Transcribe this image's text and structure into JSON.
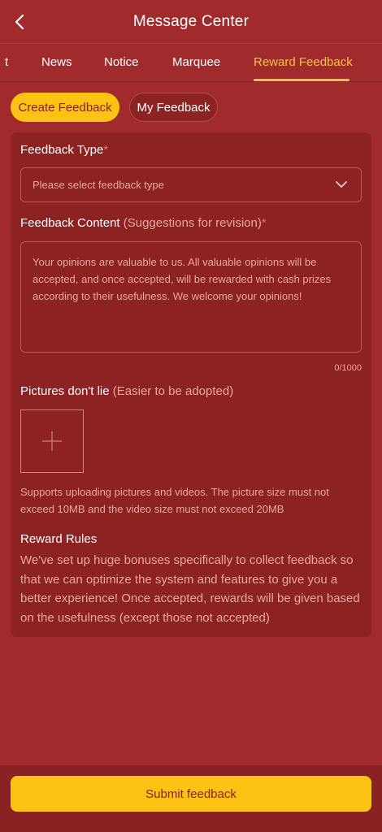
{
  "header": {
    "title": "Message Center"
  },
  "tabs": [
    {
      "label": "t"
    },
    {
      "label": "News"
    },
    {
      "label": "Notice"
    },
    {
      "label": "Marquee"
    },
    {
      "label": "Reward Feedback"
    }
  ],
  "sub_tabs": {
    "create": "Create Feedback",
    "mine": "My Feedback"
  },
  "form": {
    "type_label": "Feedback Type",
    "required_mark": "*",
    "type_placeholder": "Please select feedback type",
    "content_label": "Feedback Content",
    "content_hint": "(Suggestions for revision)",
    "content_placeholder": "Your opinions are valuable to us. All valuable opinions will be accepted, and once accepted, will be rewarded with cash prizes according to their usefulness. We welcome your opinions!",
    "counter": "0/1000",
    "pictures_label": "Pictures don't lie",
    "pictures_hint": "(Easier to be adopted)",
    "upload_hint": "Supports uploading pictures and videos. The picture size must not exceed 10MB and the video size must not exceed 20MB"
  },
  "rules": {
    "title": "Reward Rules",
    "text": "We've set up huge bonuses specifically to collect feedback so that we can optimize the system and features to give you a better experience! Once accepted, rewards will be given based on the usefulness (except those not accepted)"
  },
  "submit_label": "Submit feedback",
  "colors": {
    "background": "#a02a2c",
    "card": "#8c2222",
    "accent": "#fcc214",
    "active_tab": "#f6c344"
  },
  "icons": {
    "back": "chevron-left-icon",
    "dropdown": "chevron-down-icon",
    "upload": "plus-icon"
  }
}
